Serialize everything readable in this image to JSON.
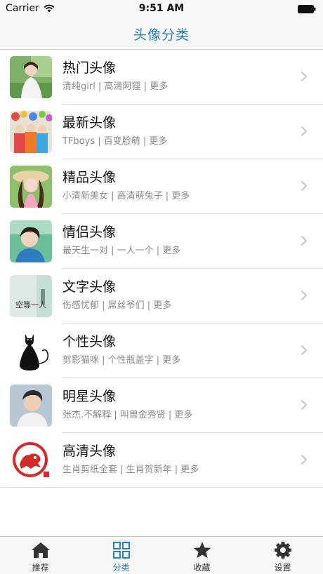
{
  "status_bar": {
    "carrier": "Carrier",
    "time": "9:51 AM"
  },
  "nav": {
    "title": "头像分类"
  },
  "categories": [
    {
      "title": "热门头像",
      "subtitle": "清纯girl | 高清阿狸 | 更多",
      "icon": "portrait-photo"
    },
    {
      "title": "最新头像",
      "subtitle": "TFboys | 百变脸萌 | 更多",
      "icon": "group-photo"
    },
    {
      "title": "精品头像",
      "subtitle": "小清新美女 | 高清萌兔子 | 更多",
      "icon": "portrait-photo"
    },
    {
      "title": "情侣头像",
      "subtitle": "最天生一对 | 一人一个 | 更多",
      "icon": "portrait-photo"
    },
    {
      "title": "文字头像",
      "subtitle": "伤感忧郁 | 屌丝爷们 | 更多",
      "icon": "text-image",
      "thumb_text": "空等一人"
    },
    {
      "title": "个性头像",
      "subtitle": "剪影猫咪 | 个性瓶盖字 | 更多",
      "icon": "cat-silhouette"
    },
    {
      "title": "明星头像",
      "subtitle": "张杰.不解释 | 叫兽金秀贤 | 更多",
      "icon": "portrait-photo"
    },
    {
      "title": "高清头像",
      "subtitle": "生肖剪纸全套 | 生肖贺新年 | 更多",
      "icon": "paper-cut-seal"
    }
  ],
  "tabs": [
    {
      "label": "推荐",
      "icon": "home-icon",
      "active": false
    },
    {
      "label": "分类",
      "icon": "grid-icon",
      "active": true
    },
    {
      "label": "收藏",
      "icon": "star-icon",
      "active": false
    },
    {
      "label": "设置",
      "icon": "gear-icon",
      "active": false
    }
  ],
  "colors": {
    "accent": "#2a7fc2",
    "bar_bg": "#f7f7f8",
    "subtitle": "#8a8a8e"
  }
}
